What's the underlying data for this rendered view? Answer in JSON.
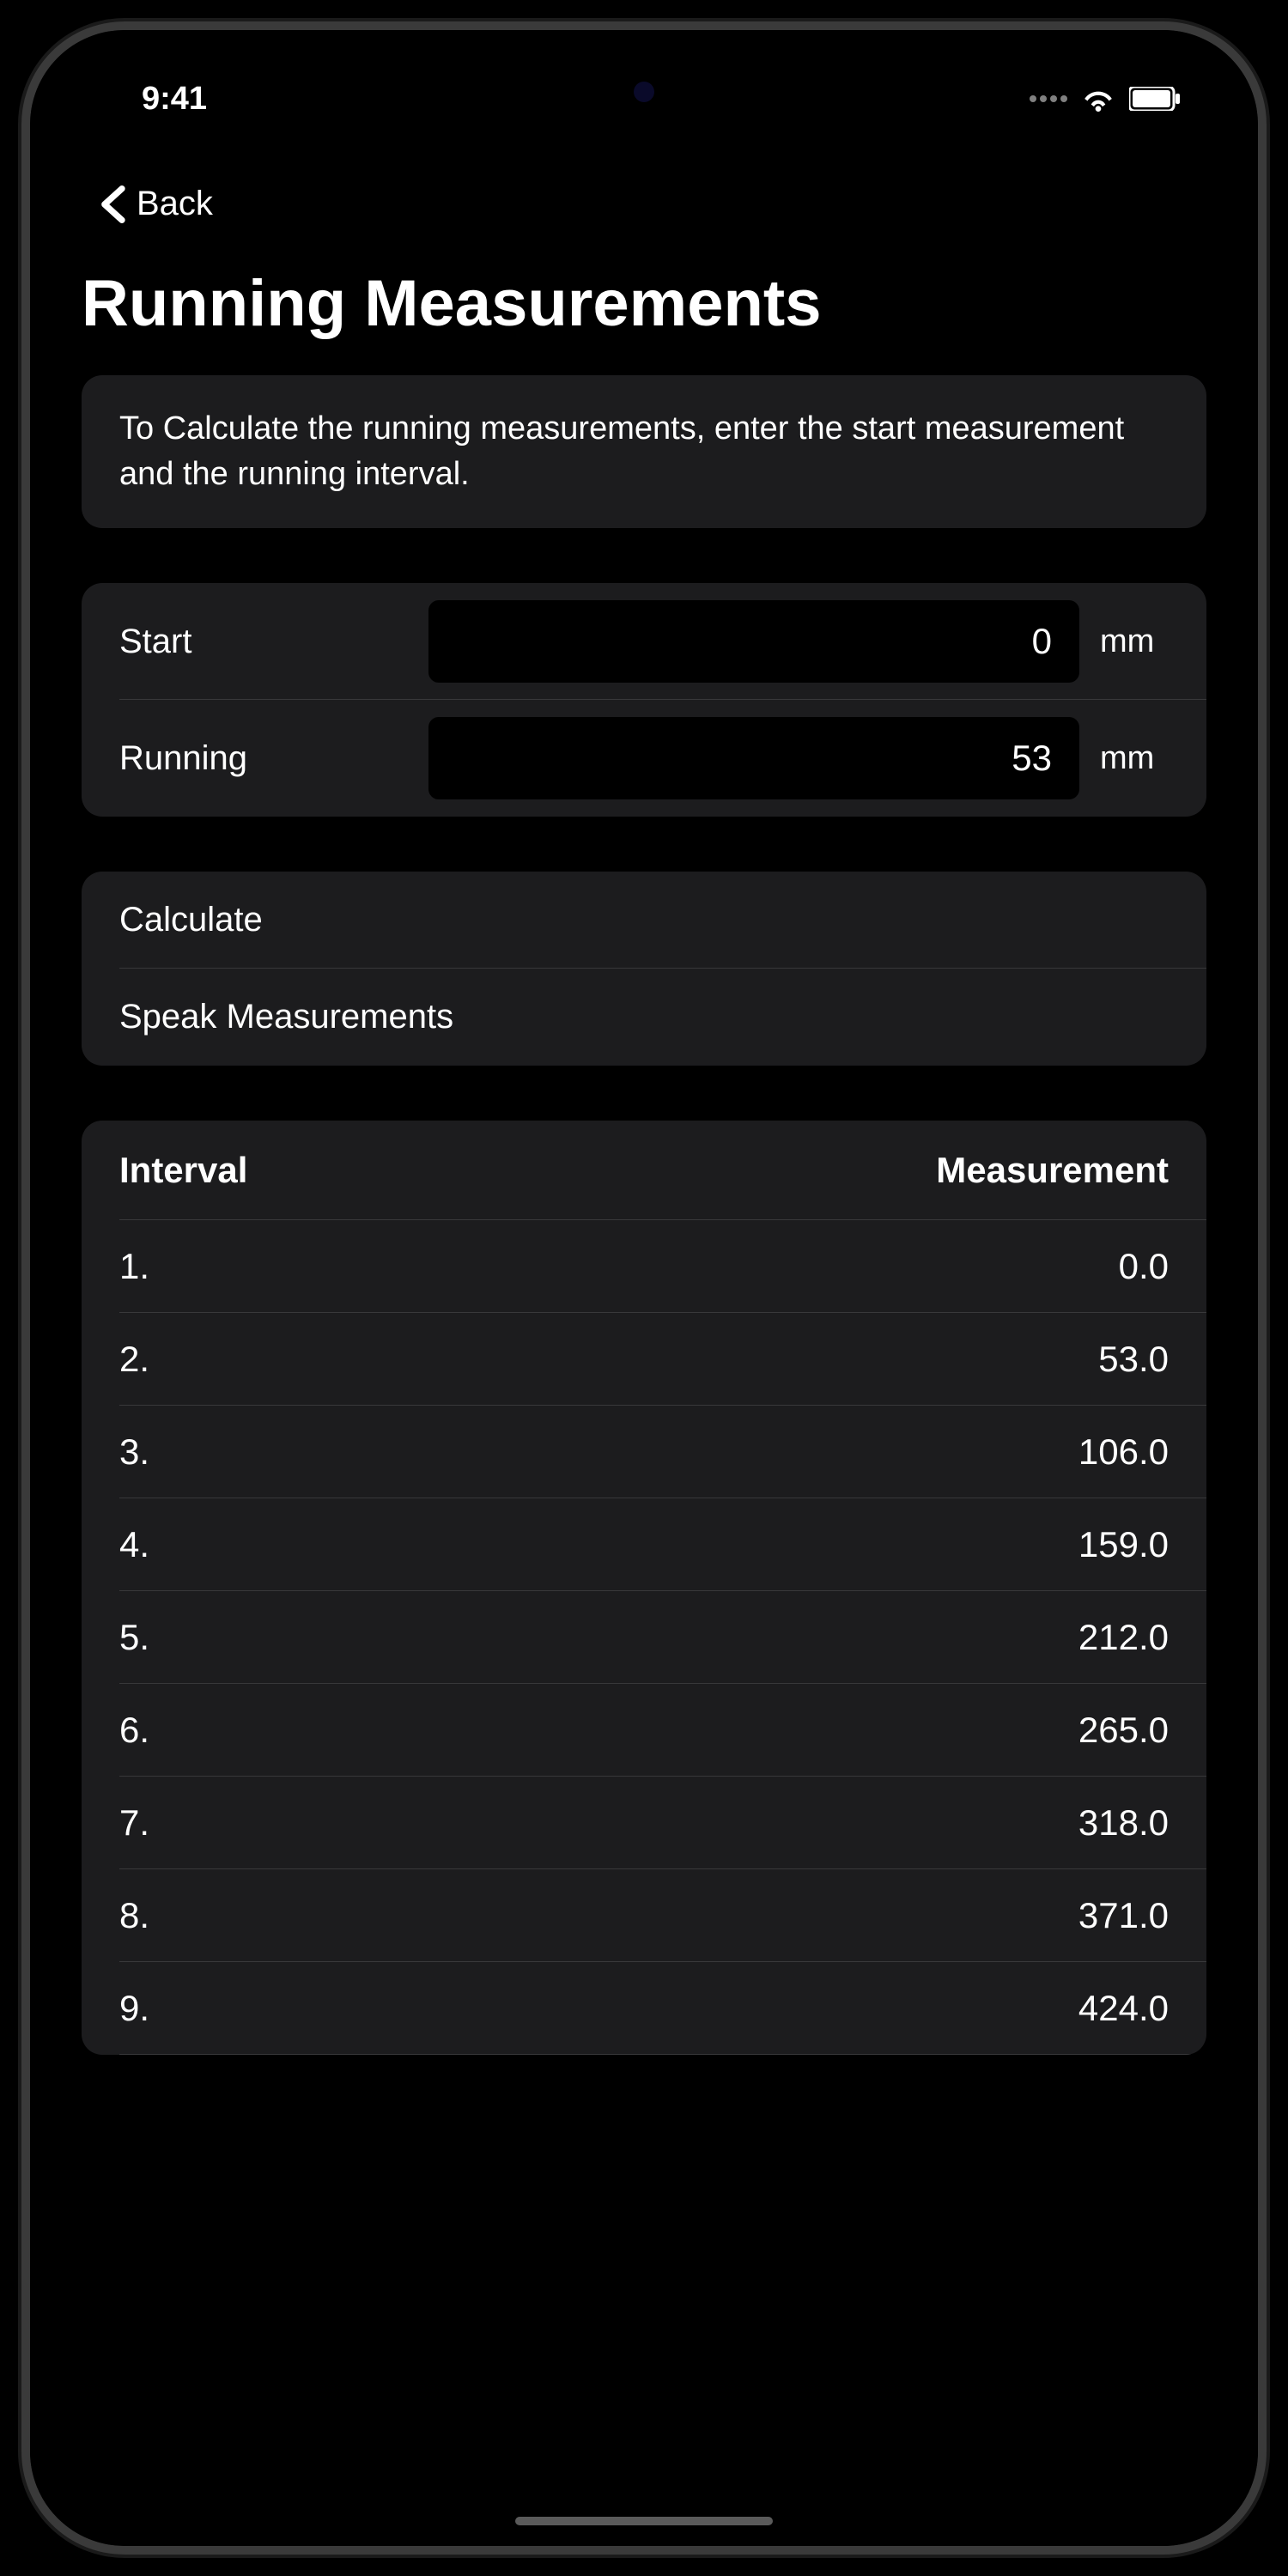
{
  "status": {
    "time": "9:41"
  },
  "nav": {
    "back_label": "Back"
  },
  "page_title": "Running Measurements",
  "info_text": "To Calculate the running measurements, enter the start measurement and the running interval.",
  "inputs": {
    "start": {
      "label": "Start",
      "value": "0",
      "unit": "mm"
    },
    "running": {
      "label": "Running",
      "value": "53",
      "unit": "mm"
    }
  },
  "actions": {
    "calculate": "Calculate",
    "speak": "Speak Measurements"
  },
  "table": {
    "header_interval": "Interval",
    "header_measurement": "Measurement",
    "rows": [
      {
        "interval": "1.",
        "measurement": "0.0"
      },
      {
        "interval": "2.",
        "measurement": "53.0"
      },
      {
        "interval": "3.",
        "measurement": "106.0"
      },
      {
        "interval": "4.",
        "measurement": "159.0"
      },
      {
        "interval": "5.",
        "measurement": "212.0"
      },
      {
        "interval": "6.",
        "measurement": "265.0"
      },
      {
        "interval": "7.",
        "measurement": "318.0"
      },
      {
        "interval": "8.",
        "measurement": "371.0"
      },
      {
        "interval": "9.",
        "measurement": "424.0"
      }
    ]
  }
}
